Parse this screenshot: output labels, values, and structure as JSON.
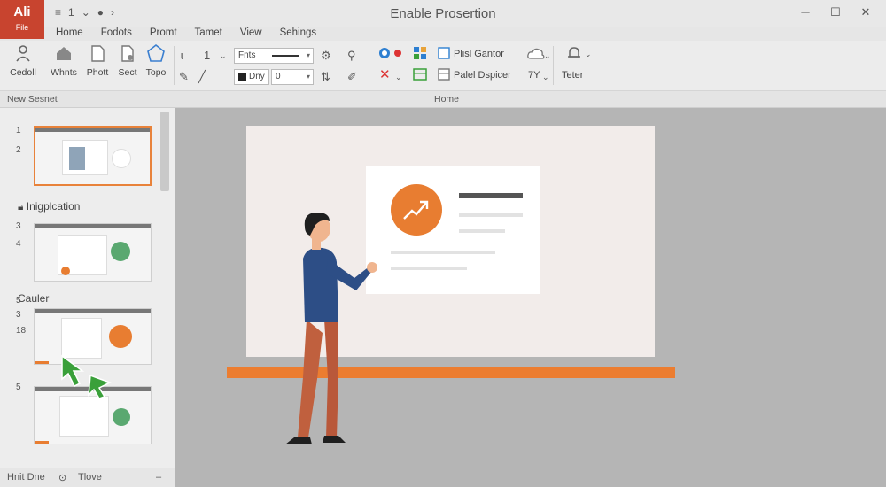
{
  "app": {
    "badge_title": "Ali",
    "badge_sub": "File"
  },
  "window": {
    "title": "Enable Prosertion"
  },
  "qat": {
    "items": [
      "≡",
      "1",
      "⌄",
      "●",
      "›"
    ]
  },
  "menu": {
    "tabs": [
      "Home",
      "Fodots",
      "Promt",
      "Tamet",
      "View",
      "Sehings"
    ]
  },
  "ribbon": {
    "buttons": [
      "Cedoll",
      "Whnts",
      "Phott",
      "Sect",
      "Topo"
    ],
    "font_box": "Fnts",
    "size_box": "Dny",
    "small1": "1",
    "small2": "0",
    "texts": [
      "Plisl Gantor",
      "Palel Dspicer",
      "Teter"
    ],
    "small_text": "7Y"
  },
  "groupbar": {
    "left": "New Sesnet",
    "center": "Home"
  },
  "panel": {
    "sections": [
      "Inigplcation",
      "Cauler"
    ],
    "slide_numbers": [
      "1",
      "2",
      "3",
      "4",
      "5",
      "3",
      "18",
      "5"
    ]
  },
  "status": {
    "left": "Hnit Dne",
    "right": "Tlove",
    "min": "–"
  },
  "colors": {
    "accent": "#e87d31",
    "brand": "#c8442f",
    "cursor": "#3aa03a"
  },
  "icons": [
    "user-icon",
    "home-icon",
    "document-icon",
    "page-icon",
    "shape-icon",
    "pen-icon",
    "gear-icon",
    "search-icon",
    "x-icon",
    "grid-icon",
    "cloud-icon",
    "bell-icon",
    "lock-icon",
    "cursor-icon"
  ]
}
